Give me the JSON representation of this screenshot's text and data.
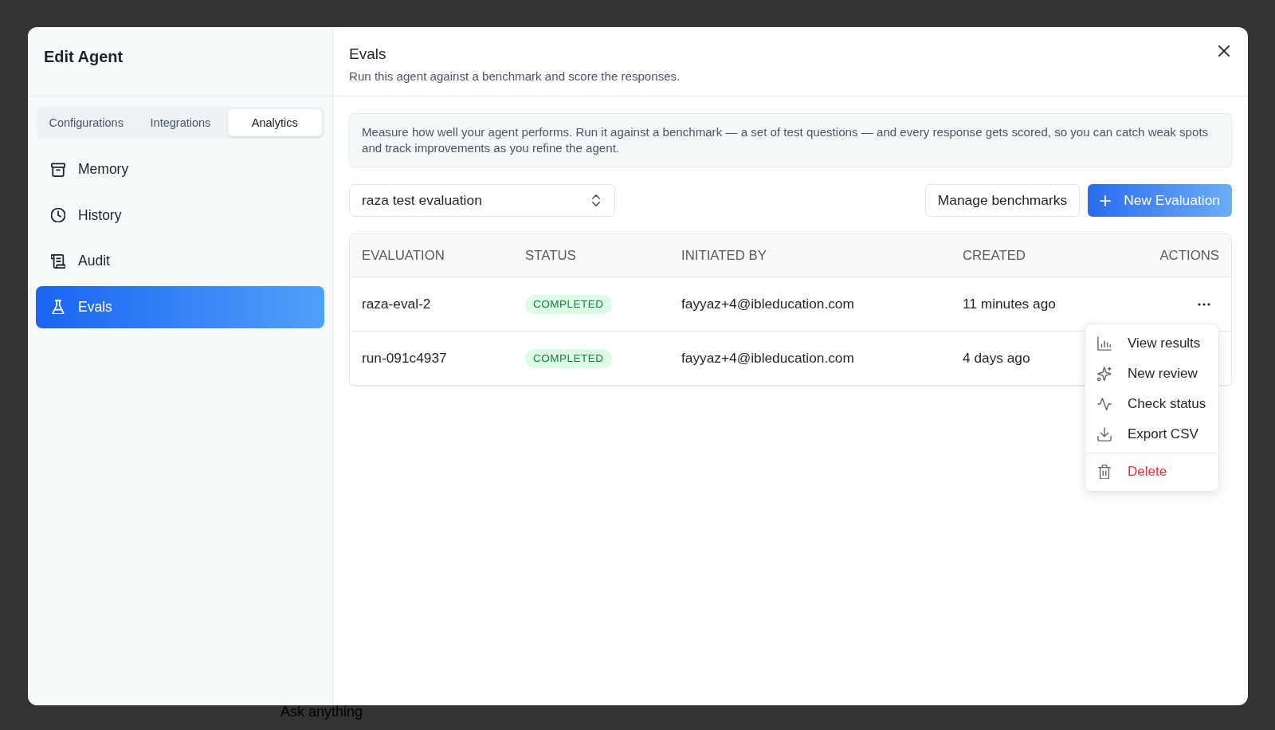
{
  "backdrop": {
    "prompt_placeholder": "Ask anything"
  },
  "dialog": {
    "sidebar": {
      "title": "Edit Agent",
      "tabs": [
        {
          "label": "Configurations",
          "selected": false
        },
        {
          "label": "Integrations",
          "selected": false
        },
        {
          "label": "Analytics",
          "selected": true
        }
      ],
      "items": [
        {
          "label": "Memory",
          "selected": false
        },
        {
          "label": "History",
          "selected": false
        },
        {
          "label": "Audit",
          "selected": false
        },
        {
          "label": "Evals",
          "selected": true
        }
      ]
    },
    "header": {
      "title": "Evals",
      "subtitle": "Run this agent against a benchmark and score the responses."
    },
    "info": "Measure how well your agent performs. Run it against a benchmark — a set of test questions — and every response gets scored, so you can catch weak spots and track improvements as you refine the agent.",
    "benchmark_select": {
      "value": "raza test evaluation"
    },
    "buttons": [
      {
        "label": "Manage benchmarks",
        "kind": "secondary"
      },
      {
        "label": "New Evaluation",
        "kind": "primary"
      }
    ],
    "table": {
      "columns": [
        "EVALUATION",
        "STATUS",
        "INITIATED BY",
        "CREATED",
        "ACTIONS"
      ],
      "rows": [
        {
          "evaluation": "raza-eval-2",
          "status": "COMPLETED",
          "initiated_by": "fayyaz+4@ibleducation.com",
          "created": "11 minutes ago"
        },
        {
          "evaluation": "run-091c4937",
          "status": "COMPLETED",
          "initiated_by": "fayyaz+4@ibleducation.com",
          "created": "4 days ago"
        }
      ]
    },
    "actions_menu": {
      "items": [
        {
          "label": "View results",
          "kind": "action"
        },
        {
          "label": "New review",
          "kind": "action"
        },
        {
          "label": "Check status",
          "kind": "action"
        },
        {
          "label": "Export CSV",
          "kind": "action"
        },
        {
          "label": "Delete",
          "kind": "danger"
        }
      ]
    }
  }
}
